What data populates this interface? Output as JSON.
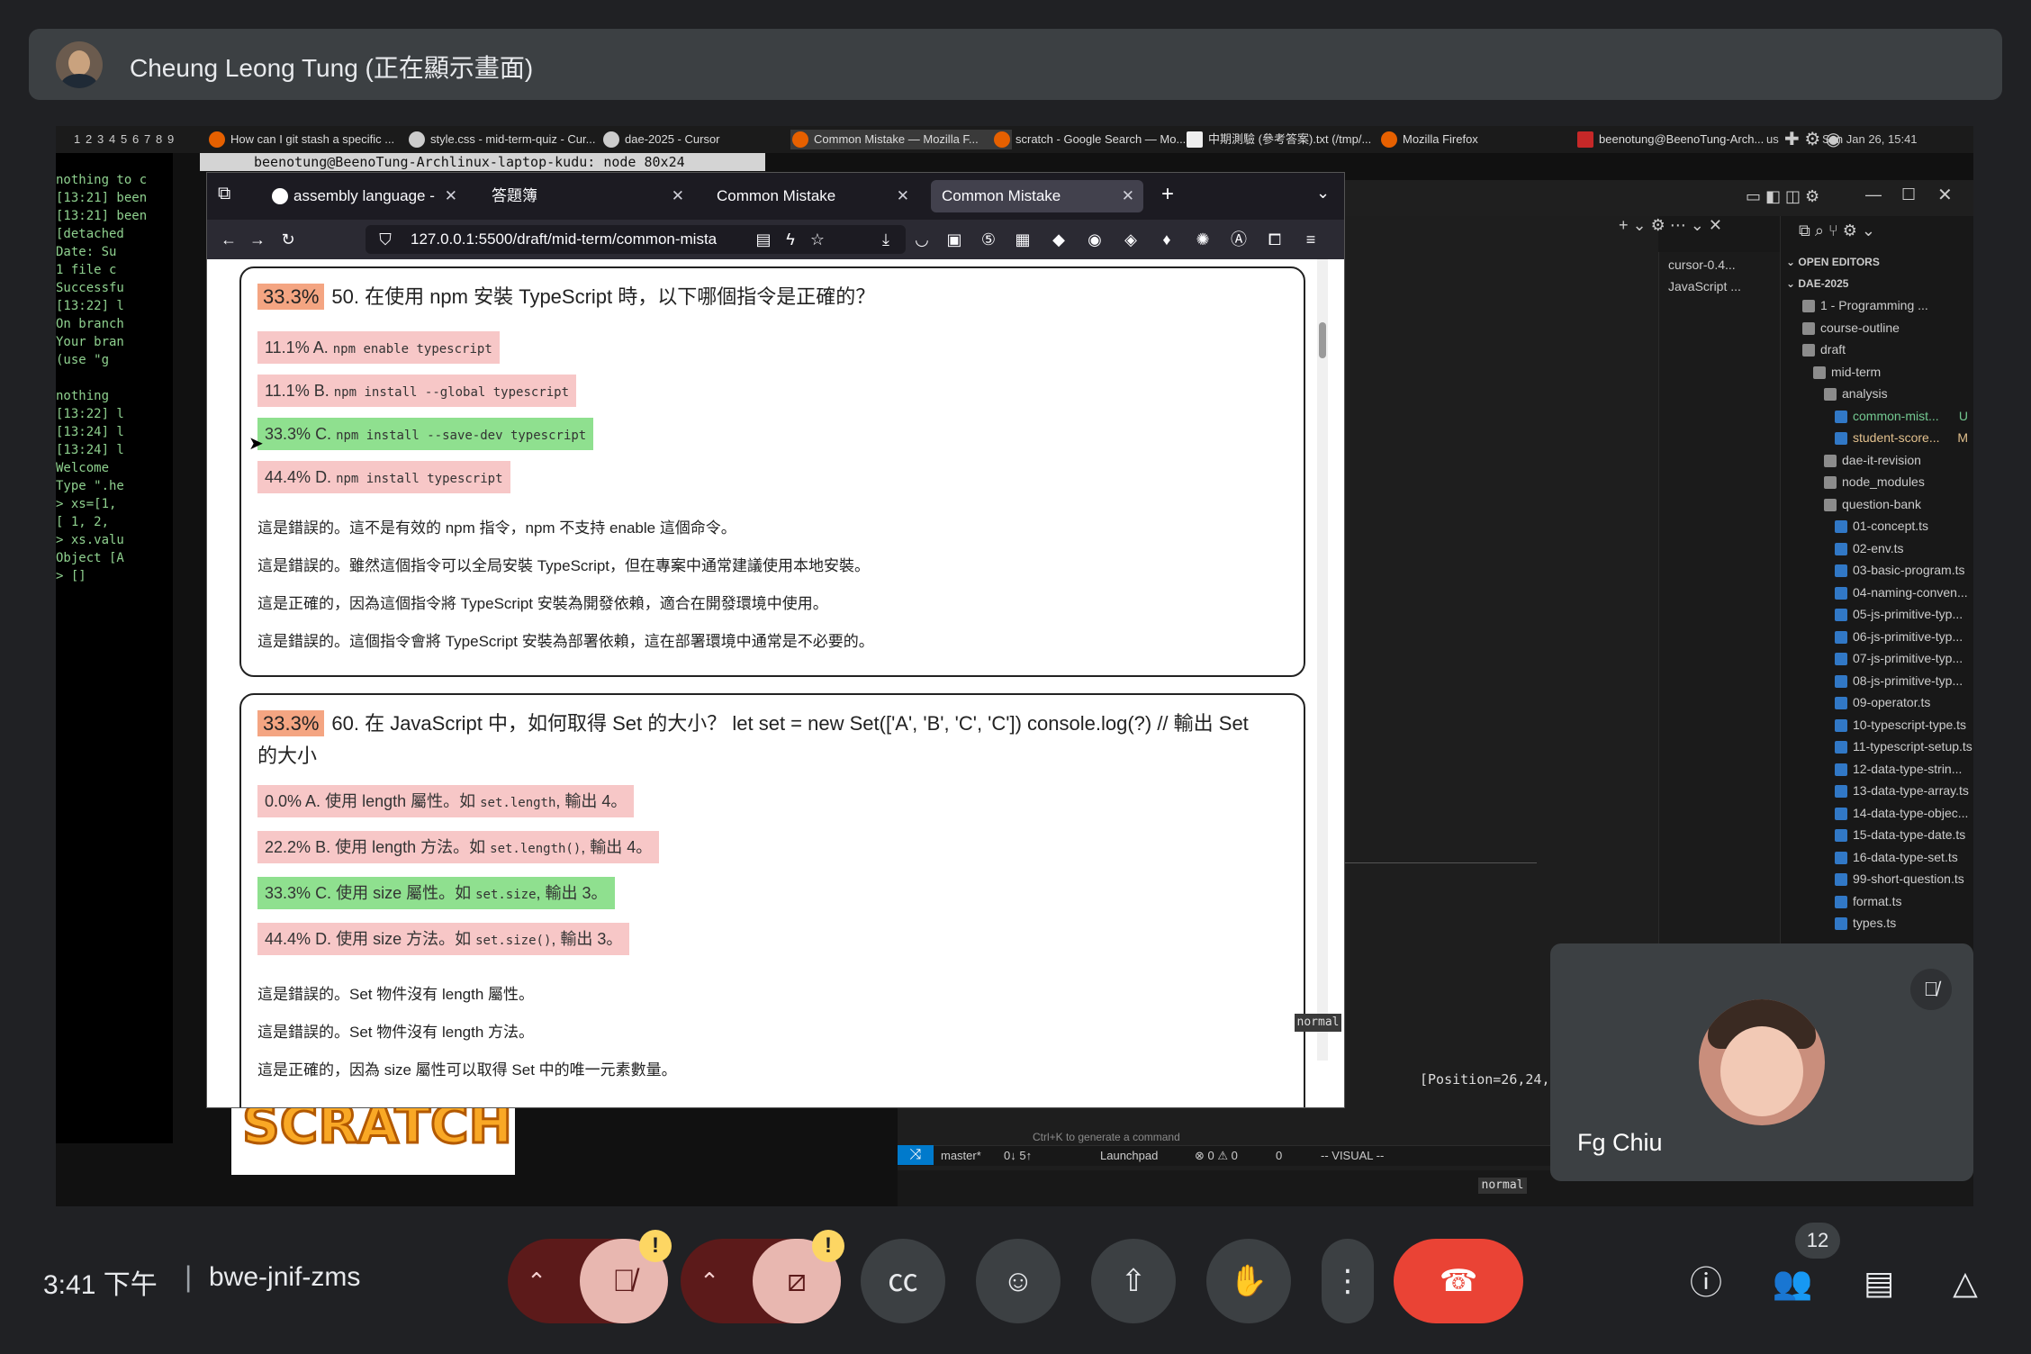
{
  "presenter": {
    "name": "Cheung Leong Tung (正在顯示畫面)"
  },
  "os": {
    "workspaces": [
      "1",
      "2",
      "3",
      "4",
      "5",
      "6",
      "7",
      "8",
      "9"
    ],
    "tasks": [
      "How can I git stash a specific ...",
      "style.css - mid-term-quiz - Cur...",
      "dae-2025 - Cursor",
      "Common Mistake — Mozilla F...",
      "scratch - Google Search — Mo...",
      "中期測驗 (參考答案).txt (/tmp/...",
      "Mozilla Firefox",
      "beenotung@BeenoTung-Arch...",
      "us"
    ],
    "clock": "Sun Jan 26, 15:41"
  },
  "terminal": {
    "title": "beenotung@BeenoTung-Archlinux-laptop-kudu: node 80x24",
    "lines": [
      "nothing to c",
      "[13:21] been",
      "[13:21] been",
      "[detached",
      " Date: Su",
      " 1 file c",
      "Successfu",
      "[13:22] l",
      "On branch",
      "Your bran",
      "  (use \"g",
      "",
      "nothing",
      "[13:22] l",
      "[13:24] l",
      "[13:24] l",
      "Welcome",
      "Type \".he",
      "> xs=[1,",
      "[ 1, 2,",
      "> xs.valu",
      "Object [A",
      "> []"
    ]
  },
  "vscode": {
    "search_value": "e-2025",
    "tabs": [
      "cursor-0.4...",
      "JavaScript ..."
    ],
    "explorer": {
      "open_editors": "OPEN EDITORS",
      "workspace": "DAE-2025",
      "items": [
        {
          "label": "1 - Programming ...",
          "kind": "folder",
          "depth": 1,
          "status": ""
        },
        {
          "label": "course-outline",
          "kind": "folder",
          "depth": 1,
          "status": ""
        },
        {
          "label": "draft",
          "kind": "folder",
          "depth": 1,
          "status": ""
        },
        {
          "label": "mid-term",
          "kind": "folder",
          "depth": 2,
          "status": ""
        },
        {
          "label": "analysis",
          "kind": "folder",
          "depth": 3,
          "status": ""
        },
        {
          "label": "common-mist...",
          "kind": "ts",
          "depth": 4,
          "status": "U"
        },
        {
          "label": "student-score...",
          "kind": "ts",
          "depth": 4,
          "status": "M"
        },
        {
          "label": "dae-it-revision",
          "kind": "folder",
          "depth": 3,
          "status": ""
        },
        {
          "label": "node_modules",
          "kind": "folder",
          "depth": 3,
          "status": ""
        },
        {
          "label": "question-bank",
          "kind": "folder",
          "depth": 3,
          "status": ""
        },
        {
          "label": "01-concept.ts",
          "kind": "ts",
          "depth": 4,
          "status": ""
        },
        {
          "label": "02-env.ts",
          "kind": "ts",
          "depth": 4,
          "status": ""
        },
        {
          "label": "03-basic-program.ts",
          "kind": "ts",
          "depth": 4,
          "status": ""
        },
        {
          "label": "04-naming-conven...",
          "kind": "ts",
          "depth": 4,
          "status": ""
        },
        {
          "label": "05-js-primitive-typ...",
          "kind": "ts",
          "depth": 4,
          "status": ""
        },
        {
          "label": "06-js-primitive-typ...",
          "kind": "ts",
          "depth": 4,
          "status": ""
        },
        {
          "label": "07-js-primitive-typ...",
          "kind": "ts",
          "depth": 4,
          "status": ""
        },
        {
          "label": "08-js-primitive-typ...",
          "kind": "ts",
          "depth": 4,
          "status": ""
        },
        {
          "label": "09-operator.ts",
          "kind": "ts",
          "depth": 4,
          "status": ""
        },
        {
          "label": "10-typescript-type.ts",
          "kind": "ts",
          "depth": 4,
          "status": ""
        },
        {
          "label": "11-typescript-setup.ts",
          "kind": "ts",
          "depth": 4,
          "status": ""
        },
        {
          "label": "12-data-type-strin...",
          "kind": "ts",
          "depth": 4,
          "status": ""
        },
        {
          "label": "13-data-type-array.ts",
          "kind": "ts",
          "depth": 4,
          "status": ""
        },
        {
          "label": "14-data-type-objec...",
          "kind": "ts",
          "depth": 4,
          "status": ""
        },
        {
          "label": "15-data-type-date.ts",
          "kind": "ts",
          "depth": 4,
          "status": ""
        },
        {
          "label": "16-data-type-set.ts",
          "kind": "ts",
          "depth": 4,
          "status": ""
        },
        {
          "label": "99-short-question.ts",
          "kind": "ts",
          "depth": 4,
          "status": ""
        },
        {
          "label": "format.ts",
          "kind": "ts",
          "depth": 4,
          "status": ""
        },
        {
          "label": "types.ts",
          "kind": "ts",
          "depth": 4,
          "status": ""
        }
      ]
    },
    "status": {
      "branch": "master*",
      "sync": "0↓ 5↑",
      "launchpad": "Launchpad",
      "problems": "⊗ 0 ⚠ 0",
      "ports": "0",
      "mode": "-- VISUAL --"
    },
    "vim_position": "[Position=26,24,:",
    "ctrl_k_hint": "Ctrl+K to generate a command",
    "vim_mode_bottom": "normal"
  },
  "firefox": {
    "tabs": [
      {
        "label": "assembly language - Goo",
        "selected": false
      },
      {
        "label": "答題簿",
        "selected": false
      },
      {
        "label": "Common Mistake",
        "selected": false
      },
      {
        "label": "Common Mistake",
        "selected": true
      }
    ],
    "url": "127.0.0.1:5500/draft/mid-term/common-mista",
    "vim_mode": "normal",
    "questions": [
      {
        "pct": "33.3%",
        "text": "50. 在使用 npm 安裝 TypeScript 時，以下哪個指令是正確的？",
        "options": [
          {
            "pct": "11.1%",
            "letter": "A.",
            "code": "npm enable typescript",
            "correct": false
          },
          {
            "pct": "11.1%",
            "letter": "B.",
            "code": "npm install --global typescript",
            "correct": false
          },
          {
            "pct": "33.3%",
            "letter": "C.",
            "code": "npm install --save-dev typescript",
            "correct": true
          },
          {
            "pct": "44.4%",
            "letter": "D.",
            "code": "npm install typescript",
            "correct": false
          }
        ],
        "explanations": [
          "這是錯誤的。這不是有效的 npm 指令，npm 不支持 enable 這個命令。",
          "這是錯誤的。雖然這個指令可以全局安裝 TypeScript，但在專案中通常建議使用本地安裝。",
          "這是正確的，因為這個指令將 TypeScript 安裝為開發依賴，適合在開發環境中使用。",
          "這是錯誤的。這個指令會將 TypeScript 安裝為部署依賴，這在部署環境中通常是不必要的。"
        ]
      },
      {
        "pct": "33.3%",
        "text_line1": "60. 在 JavaScript 中，如何取得 Set 的大小？ let set = new Set(['A', 'B', 'C', 'C']) console.log(?) // 輸出 Set",
        "text_line2": "的大小",
        "options": [
          {
            "pct": "0.0%",
            "letter": "A.",
            "pre": "使用 length 屬性。如 ",
            "code": "set.length",
            "post": ", 輸出 4。",
            "correct": false
          },
          {
            "pct": "22.2%",
            "letter": "B.",
            "pre": "使用 length 方法。如 ",
            "code": "set.length()",
            "post": ", 輸出 4。",
            "correct": false
          },
          {
            "pct": "33.3%",
            "letter": "C.",
            "pre": "使用 size 屬性。如 ",
            "code": "set.size",
            "post": ", 輸出 3。",
            "correct": true
          },
          {
            "pct": "44.4%",
            "letter": "D.",
            "pre": "使用 size 方法。如 ",
            "code": "set.size()",
            "post": ", 輸出 3。",
            "correct": false
          }
        ],
        "explanations": [
          "這是錯誤的。Set 物件沒有 length 屬性。",
          "這是錯誤的。Set 物件沒有 length 方法。",
          "這是正確的，因為 size 屬性可以取得 Set 中的唯一元素數量。"
        ]
      }
    ]
  },
  "participant": {
    "name": "Fg Chiu"
  },
  "meeting": {
    "time": "3:41 下午",
    "separator": "|",
    "code": "bwe-jnif-zms",
    "people_count": "12"
  },
  "colors": {
    "correct": "#8fe08f",
    "wrong": "#f7c7c7",
    "badge": "#f4a582",
    "end_call": "#ea4335",
    "warning": "#fdd663"
  }
}
